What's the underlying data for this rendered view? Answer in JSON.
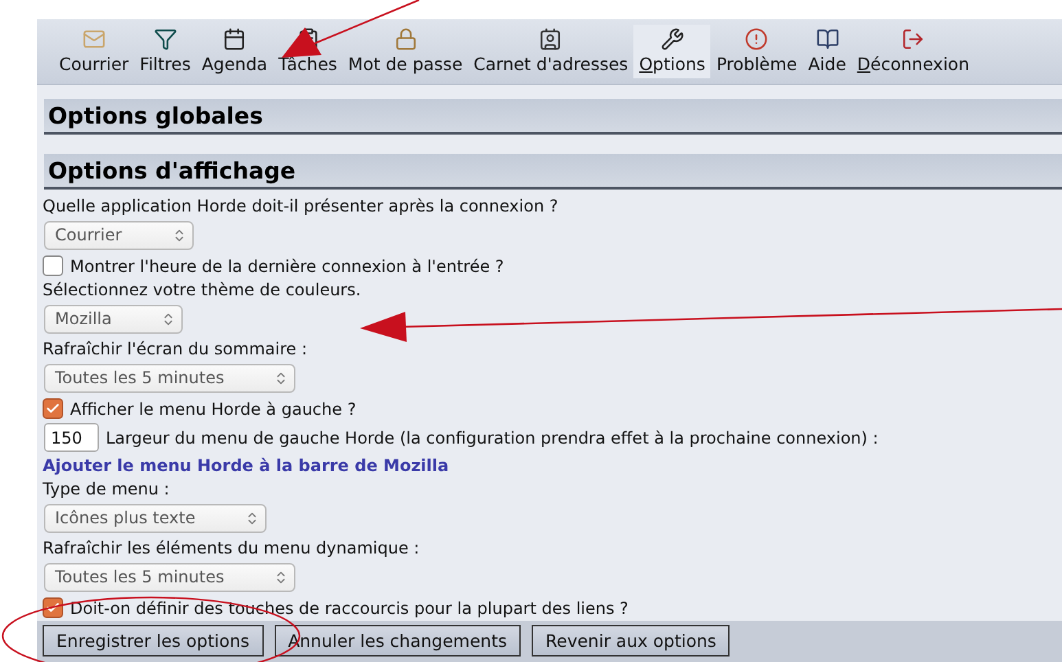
{
  "toolbar": [
    {
      "label": "Courrier",
      "selected": false,
      "underline_first": false
    },
    {
      "label": "Filtres",
      "selected": false,
      "underline_first": false
    },
    {
      "label": "Agenda",
      "selected": false,
      "underline_first": false
    },
    {
      "label": "Tâches",
      "selected": false,
      "underline_first": false
    },
    {
      "label": "Mot de passe",
      "selected": false,
      "underline_first": false
    },
    {
      "label": "Carnet d'adresses",
      "selected": false,
      "underline_first": false
    },
    {
      "label": "Options",
      "selected": true,
      "underline_first": true
    },
    {
      "label": "Problème",
      "selected": false,
      "underline_first": false
    },
    {
      "label": "Aide",
      "selected": false,
      "underline_first": false
    },
    {
      "label": "Déconnexion",
      "selected": false,
      "underline_first": true
    }
  ],
  "sections": [
    {
      "title": "Options globales"
    },
    {
      "title": "Options d'affichage"
    }
  ],
  "form": [
    {
      "kind": "label",
      "text": "Quelle application Horde doit-il présenter après la connexion ?"
    },
    {
      "kind": "select",
      "value": "Courrier"
    },
    {
      "kind": "checkbox",
      "text": "Montrer l'heure de la dernière connexion à l'entrée ?",
      "checked": false
    },
    {
      "kind": "label",
      "text": "Sélectionnez votre thème de couleurs."
    },
    {
      "kind": "select",
      "value": "Mozilla"
    },
    {
      "kind": "label",
      "text": "Rafraîchir l'écran du sommaire :"
    },
    {
      "kind": "select",
      "value": "Toutes les 5 minutes"
    },
    {
      "kind": "checkbox",
      "text": "Afficher le menu Horde à gauche ?",
      "checked": true
    },
    {
      "kind": "input",
      "value": "150",
      "text": "Largeur du menu de gauche Horde (la configuration prendra effet à la prochaine connexion) :"
    },
    {
      "kind": "link",
      "text": "Ajouter le menu Horde à la barre de Mozilla"
    },
    {
      "kind": "label",
      "text": "Type de menu :"
    },
    {
      "kind": "select",
      "value": "Icônes plus texte"
    },
    {
      "kind": "label",
      "text": "Rafraîchir les éléments du menu dynamique :"
    },
    {
      "kind": "select",
      "value": "Toutes les 5 minutes"
    },
    {
      "kind": "checkbox",
      "text": "Doit-on définir des touches de raccourcis pour la plupart des liens ?",
      "checked": true
    }
  ],
  "buttons": [
    "Enregistrer les options",
    "Annuler les changements",
    "Revenir aux options"
  ]
}
